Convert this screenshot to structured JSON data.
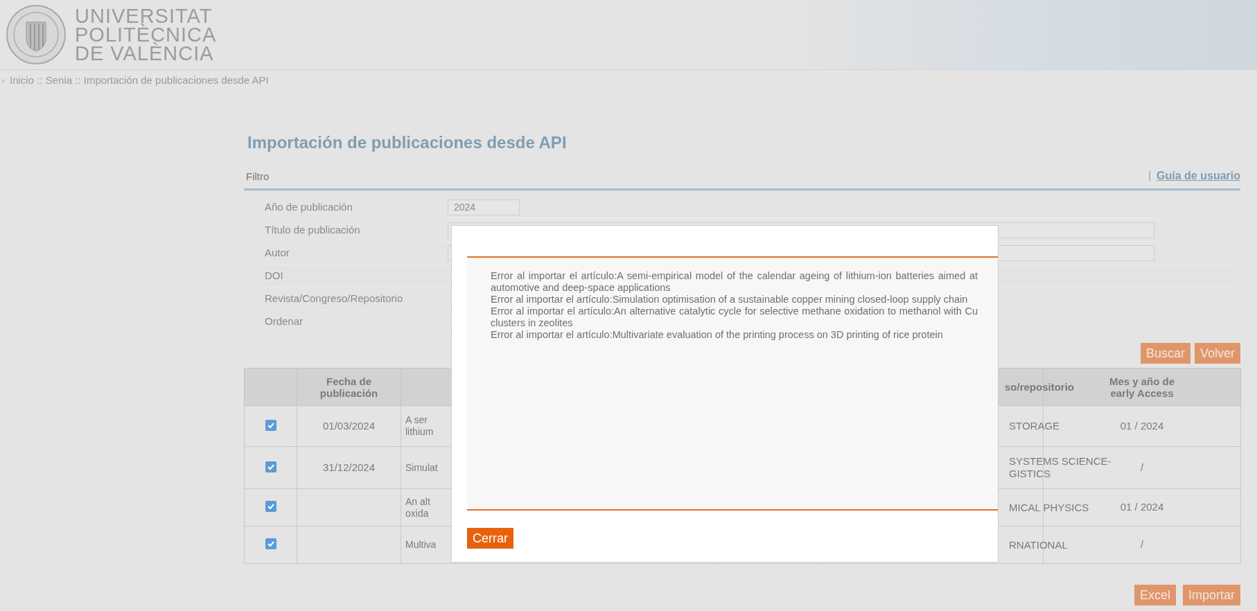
{
  "header": {
    "logo_lines": [
      "UNIVERSITAT",
      "POLITÈCNICA",
      "DE VALÈNCIA"
    ]
  },
  "breadcrumb_marker": "›",
  "breadcrumb": "Inicio :: Senia :: Importación de publicaciones desde API",
  "title": "Importación de publicaciones desde API",
  "filter": {
    "label": "Filtro",
    "separator": "|",
    "guide_link": "Guía de usuario",
    "fields": [
      {
        "label": "Año de publicación",
        "kind": "short-input",
        "value": "2024"
      },
      {
        "label": "Título de publicación",
        "kind": "long-input"
      },
      {
        "label": "Autor",
        "kind": "long-input"
      },
      {
        "label": "DOI"
      },
      {
        "label": "Revista/Congreso/Repositorio"
      },
      {
        "label": "Ordenar"
      }
    ],
    "buttons": [
      "Buscar",
      "Volver"
    ]
  },
  "table": {
    "columns": [
      "",
      "Fecha de publicación",
      "",
      "",
      "so/repositorio",
      "Mes y año de early Access"
    ],
    "rows": [
      {
        "checked": true,
        "date": "01/03/2024",
        "column_3": [
          "A ser",
          "lithium"
        ],
        "column_5": [
          "STORAGE"
        ],
        "early_access": "01 / 2024"
      },
      {
        "checked": true,
        "date": "31/12/2024",
        "column_3": [
          "Simulat"
        ],
        "column_5": [
          "SYSTEMS SCIENCE-",
          "GISTICS"
        ],
        "early_access": "/"
      },
      {
        "checked": true,
        "date": "",
        "column_3": [
          "An alt",
          "oxida"
        ],
        "column_5": [
          "MICAL PHYSICS"
        ],
        "early_access": "01 / 2024"
      },
      {
        "checked": true,
        "date": "",
        "column_3": [
          "Multiva"
        ],
        "column_5": [
          "RNATIONAL"
        ],
        "early_access": "/"
      }
    ]
  },
  "footer_buttons": [
    "Excel",
    "Importar"
  ],
  "modal": {
    "messages": [
      "Error al importar el artículo:A semi-empirical model of the calendar ageing of lithium-ion batteries aimed at automotive and deep-space applications",
      "Error al importar el artículo:Simulation optimisation of a sustainable copper mining closed-loop supply chain",
      "Error al importar el artículo:An alternative catalytic cycle for selective methane oxidation to methanol with Cu clusters in zeolites",
      "Error al importar el artículo:Multivariate evaluation of the printing process on 3D printing of rice protein"
    ],
    "close_button": "Cerrar"
  }
}
